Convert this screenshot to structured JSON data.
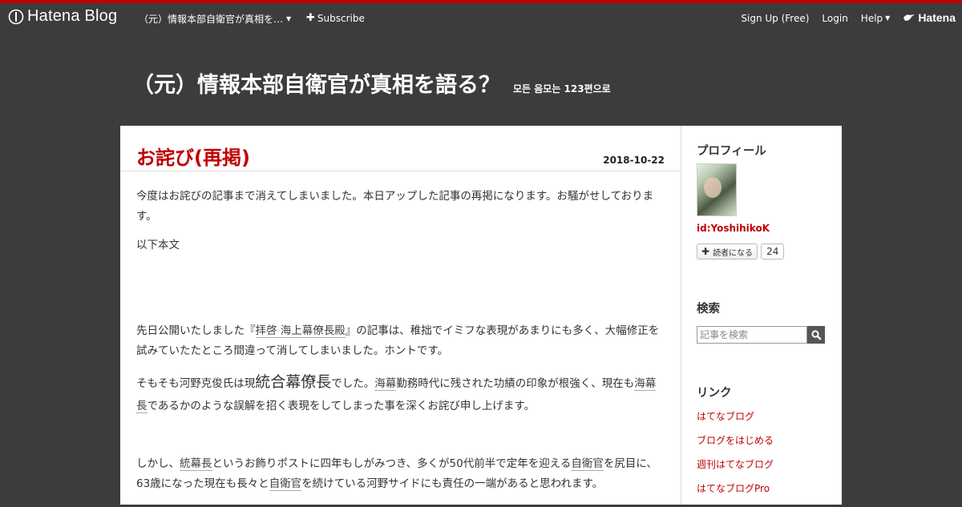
{
  "globalbar": {
    "brand": "Hatena Blog",
    "blog_menu": "（元）情報本部自衛官が真相を…",
    "subscribe": "Subscribe",
    "signup": "Sign Up (Free)",
    "login": "Login",
    "help": "Help",
    "hatena": "Hatena"
  },
  "blog": {
    "title": "（元）情報本部自衛官が真相を語る？",
    "description": "모든 음모는 123편으로"
  },
  "entry": {
    "title": "お詫び(再掲)",
    "date": "2018-10-22",
    "p1": "今度はお詫びの記事まで消えてしまいました。本日アップした記事の再掲になります。お騒がせしております。",
    "p2": "以下本文",
    "p3a": "先日公開いたしました『",
    "p3_link": "拝啓 海上幕僚長殿",
    "p3b": "』の記事は、稚拙でイミフな表現があまりにも多く、大幅修正を試みていたたところ間違って消してしまいました。ホントです。",
    "p4a": "そもそも",
    "p4_k1": "河野克俊",
    "p4b": "氏は現",
    "p4_big": "統合幕僚長",
    "p4c": "でした。",
    "p4_k2": "海幕",
    "p4d": "勤務時代に残された功績の印象が根強く、現在も",
    "p4_k3": "海幕長",
    "p4e": "であるかのような誤解を招く表現をしてしまった事を深くお詫び申し上げます。",
    "p5a": "しかし、",
    "p5_k1": "統幕長",
    "p5b": "というお飾りポストに四年もしがみつき、多くが50代前半で定年を迎える",
    "p5_k2": "自衛官",
    "p5c": "を尻目に、63歳になった現在も長々と",
    "p5_k3": "自衛官",
    "p5d": "を続けている河野サイドにも責任の一端があると思われます。"
  },
  "sidebar": {
    "profile_heading": "プロフィール",
    "profile_id": "id:YoshihikoK",
    "reader_button": "読者になる",
    "reader_count": "24",
    "search_heading": "検索",
    "search_placeholder": "記事を検索",
    "links_heading": "リンク",
    "links": [
      "はてなブログ",
      "ブログをはじめる",
      "週刊はてなブログ",
      "はてなブログPro"
    ]
  },
  "colors": {
    "accent": "#c00000",
    "background": "#3c3c3c",
    "panel": "#ffffff"
  }
}
